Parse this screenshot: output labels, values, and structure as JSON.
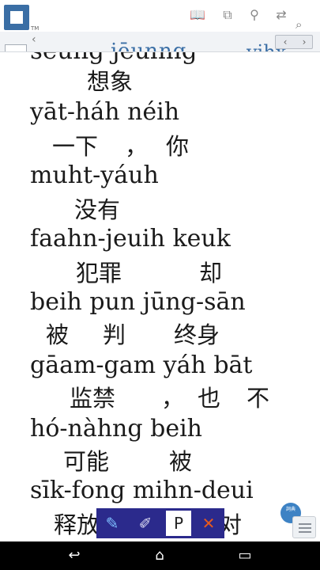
{
  "toolbar": {
    "logo_tm": "TM",
    "icons": [
      "book-icon",
      "copy-icon",
      "stamp-icon",
      "swap-icon"
    ],
    "icon_glyphs": [
      "📖",
      "⧉",
      "⚲",
      "⇄"
    ]
  },
  "navbar": {
    "back_glyph": "‹",
    "peek_text": "jēunng",
    "peek_right": "yihx",
    "pager_prev": "‹",
    "pager_next": "›",
    "search_glyph": "⌕"
  },
  "content": {
    "peek_roman": "seung jēunng",
    "entries": [
      {
        "roman": "",
        "hanzi": [
          {
            "text": "想象",
            "pos": "a"
          }
        ]
      },
      {
        "roman": "yāt-háh    néih",
        "hanzi": [
          {
            "text": "一下",
            "pos": "b"
          },
          {
            "text": "，",
            "pos": "c"
          },
          {
            "text": "你",
            "pos": "d"
          }
        ]
      },
      {
        "roman": "muht-yáuh",
        "hanzi": [
          {
            "text": "没有",
            "pos": "e"
          }
        ]
      },
      {
        "roman": "faahn-jeuih keuk",
        "hanzi": [
          {
            "text": "犯罪",
            "pos": "f"
          },
          {
            "text": "却",
            "pos": "g"
          }
        ]
      },
      {
        "roman": "beih pun jūng-sān",
        "hanzi": [
          {
            "text": "被",
            "pos": "h"
          },
          {
            "text": "判",
            "pos": "i"
          },
          {
            "text": "终身",
            "pos": "j"
          }
        ]
      },
      {
        "roman": "gāam-gam    yáh bāt",
        "hanzi": [
          {
            "text": "监禁",
            "pos": "k"
          },
          {
            "text": "，",
            "pos": "l"
          },
          {
            "text": "也",
            "pos": "m"
          },
          {
            "text": "不",
            "pos": "n"
          }
        ]
      },
      {
        "roman": "hó-nàhng beih",
        "hanzi": [
          {
            "text": "可能",
            "pos": "o"
          },
          {
            "text": "被",
            "pos": "p"
          }
        ]
      },
      {
        "roman": "sīk-fong    mihn-deui",
        "hanzi": [
          {
            "text": "释放",
            "pos": "q"
          },
          {
            "text": "面对",
            "pos": "r"
          }
        ]
      }
    ]
  },
  "fab": {
    "label": "詞典"
  },
  "floatbar": {
    "items": [
      "brush-icon",
      "clipboard-icon",
      "p-icon",
      "close-icon"
    ],
    "p_label": "P",
    "x_label": "✕"
  },
  "system_nav": {
    "back_glyph": "↩",
    "home_glyph": "⌂",
    "recents_glyph": "▭"
  }
}
